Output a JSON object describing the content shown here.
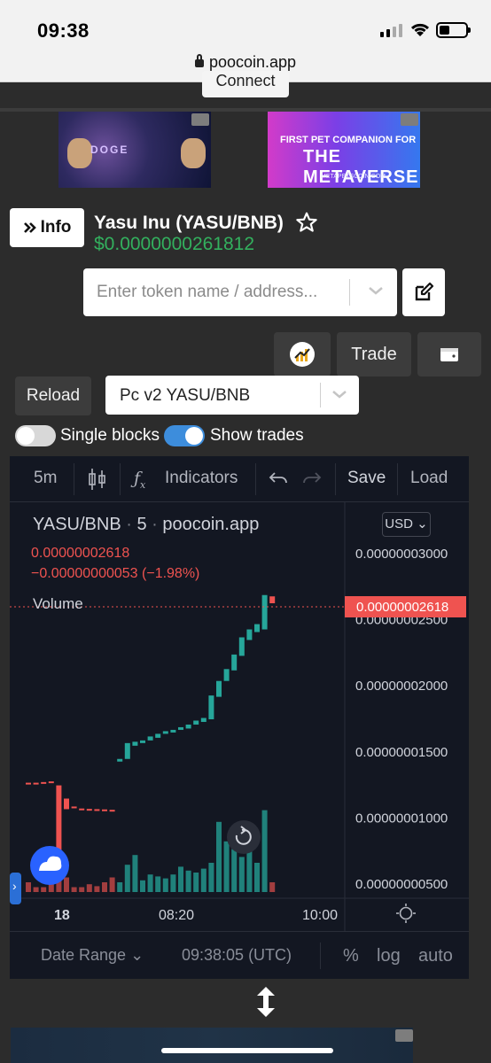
{
  "status": {
    "time": "09:38",
    "url": "poocoin.app"
  },
  "header": {
    "connect_label": "Connect"
  },
  "banners": {
    "left_text": "DOGE",
    "right_line1": "FIRST PET COMPANION FOR",
    "right_line2": "THE METAVERSE",
    "right_small": "METAPETSCOIN.COM"
  },
  "token": {
    "info_label": "Info",
    "name": "Yasu Inu (YASU/BNB)",
    "price": "$0.0000000261812"
  },
  "search": {
    "placeholder": "Enter token name / address..."
  },
  "actions": {
    "trade_label": "Trade",
    "reload_label": "Reload"
  },
  "pair_select": {
    "value": "Pc v2 YASU/BNB"
  },
  "toggles": {
    "single_blocks": {
      "label": "Single blocks",
      "on": false
    },
    "show_trades": {
      "label": "Show trades",
      "on": true
    }
  },
  "chart_toolbar": {
    "interval": "5m",
    "indicators": "Indicators",
    "save": "Save",
    "load": "Load"
  },
  "chart_legend": {
    "symbol": "YASU/BNB",
    "interval": "5",
    "source": "poocoin.app",
    "last": "0.00000002618",
    "change": "−0.00000000053 (−1.98%)",
    "volume_label": "Volume",
    "currency": "USD"
  },
  "chart_bottom": {
    "date_range": "Date Range",
    "clock": "09:38:05 (UTC)",
    "percent": "%",
    "log": "log",
    "auto": "auto"
  },
  "colors": {
    "up": "#26a69a",
    "down": "#ef5350",
    "price_green": "#33b05e",
    "accent_blue": "#3d8ddc"
  },
  "chart_data": {
    "type": "candlestick",
    "y_ticks": [
      "0.00000003000",
      "0.00000002500",
      "0.00000002000",
      "0.00000001500",
      "0.00000001000",
      "0.00000000500"
    ],
    "x_ticks": [
      "18",
      "08:20",
      "10:00"
    ],
    "last_price_label": "0.00000002618",
    "candles": [
      {
        "o": 1.26e-08,
        "c": 1.26e-08,
        "dir": "flat"
      },
      {
        "o": 1.26e-08,
        "c": 1.25e-08,
        "dir": "down"
      },
      {
        "o": 1.265e-08,
        "c": 1.255e-08,
        "dir": "down"
      },
      {
        "o": 1.27e-08,
        "c": 1.262e-08,
        "dir": "down"
      },
      {
        "o": 1.24e-08,
        "c": 5.8e-09,
        "dir": "down"
      },
      {
        "o": 1.14e-08,
        "c": 1.06e-08,
        "dir": "down"
      },
      {
        "o": 1.08e-08,
        "c": 1.07e-08,
        "dir": "down"
      },
      {
        "o": 1.065e-08,
        "c": 1.06e-08,
        "dir": "down"
      },
      {
        "o": 1.062e-08,
        "c": 1.058e-08,
        "dir": "down"
      },
      {
        "o": 1.06e-08,
        "c": 1.058e-08,
        "dir": "down"
      },
      {
        "o": 1.058e-08,
        "c": 1.055e-08,
        "dir": "down"
      },
      {
        "o": 1.055e-08,
        "c": 1.05e-08,
        "dir": "down"
      },
      {
        "o": 1.42e-08,
        "c": 1.44e-08,
        "dir": "up"
      },
      {
        "o": 1.44e-08,
        "c": 1.56e-08,
        "dir": "up"
      },
      {
        "o": 1.54e-08,
        "c": 1.57e-08,
        "dir": "up"
      },
      {
        "o": 1.56e-08,
        "c": 1.58e-08,
        "dir": "up"
      },
      {
        "o": 1.58e-08,
        "c": 1.61e-08,
        "dir": "up"
      },
      {
        "o": 1.6e-08,
        "c": 1.63e-08,
        "dir": "up"
      },
      {
        "o": 1.63e-08,
        "c": 1.65e-08,
        "dir": "up"
      },
      {
        "o": 1.64e-08,
        "c": 1.66e-08,
        "dir": "up"
      },
      {
        "o": 1.66e-08,
        "c": 1.68e-08,
        "dir": "up"
      },
      {
        "o": 1.67e-08,
        "c": 1.7e-08,
        "dir": "up"
      },
      {
        "o": 1.7e-08,
        "c": 1.73e-08,
        "dir": "up"
      },
      {
        "o": 1.72e-08,
        "c": 1.75e-08,
        "dir": "up"
      },
      {
        "o": 1.74e-08,
        "c": 1.92e-08,
        "dir": "up"
      },
      {
        "o": 1.91e-08,
        "c": 2.03e-08,
        "dir": "up"
      },
      {
        "o": 2.03e-08,
        "c": 2.12e-08,
        "dir": "up"
      },
      {
        "o": 2.11e-08,
        "c": 2.23e-08,
        "dir": "up"
      },
      {
        "o": 2.22e-08,
        "c": 2.36e-08,
        "dir": "up"
      },
      {
        "o": 2.34e-08,
        "c": 2.42e-08,
        "dir": "up"
      },
      {
        "o": 2.4e-08,
        "c": 2.46e-08,
        "dir": "up"
      },
      {
        "o": 2.42e-08,
        "c": 2.68e-08,
        "dir": "up"
      },
      {
        "o": 2.67e-08,
        "c": 2.618e-08,
        "dir": "down"
      }
    ],
    "volume": [
      0.1,
      0.05,
      0.05,
      0.1,
      0.3,
      0.15,
      0.05,
      0.05,
      0.08,
      0.06,
      0.1,
      0.15,
      0.1,
      0.28,
      0.38,
      0.12,
      0.18,
      0.16,
      0.14,
      0.18,
      0.26,
      0.22,
      0.2,
      0.24,
      0.3,
      0.72,
      0.52,
      0.44,
      0.36,
      0.5,
      0.3,
      0.84,
      0.1
    ]
  }
}
